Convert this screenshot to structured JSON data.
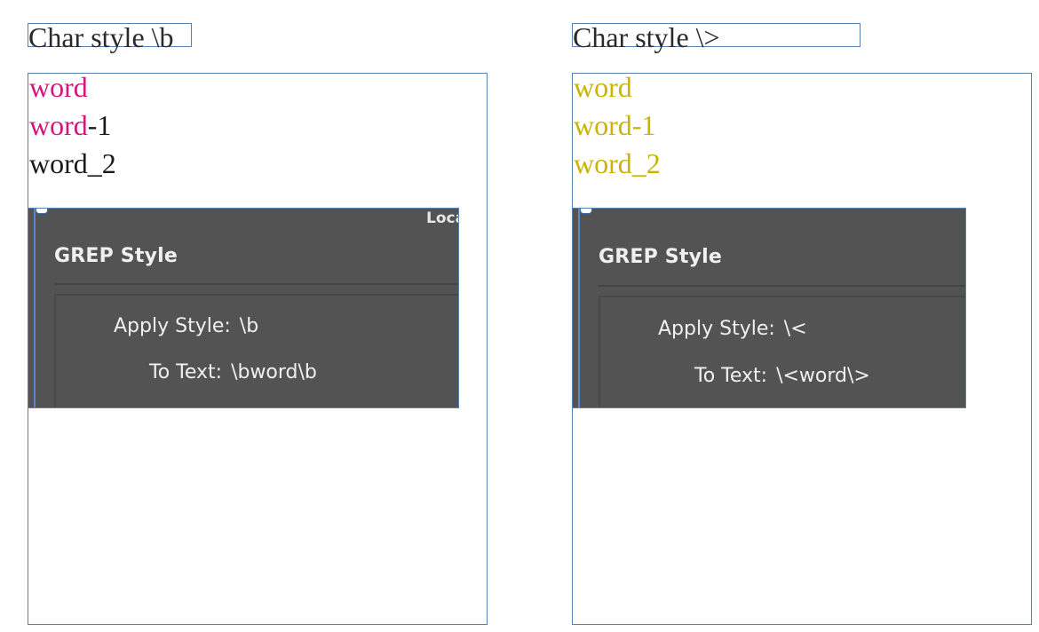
{
  "left": {
    "heading": "Char style \\b",
    "lines": [
      {
        "styled": "word",
        "rest": ""
      },
      {
        "styled": "word",
        "rest": "-1"
      },
      {
        "styled": "",
        "rest": "word_2"
      }
    ],
    "panel": {
      "corner_label": "Loca",
      "title": "GREP Style",
      "apply_style_label": "Apply Style:",
      "apply_style_value": "\\b",
      "to_text_label": "To Text:",
      "to_text_value": "\\bword\\b"
    }
  },
  "right": {
    "heading": "Char style \\>",
    "lines": [
      {
        "styled": "word",
        "rest": ""
      },
      {
        "styled": "word-1",
        "rest": ""
      },
      {
        "styled": "word_2",
        "rest": ""
      }
    ],
    "panel": {
      "title": "GREP Style",
      "apply_style_label": "Apply Style:",
      "apply_style_value": "\\<",
      "to_text_label": "To Text:",
      "to_text_value": "\\<word\\>"
    }
  },
  "colors": {
    "magenta": "#d3157f",
    "yellow": "#c9b400",
    "frame_border": "#5b7fae",
    "panel_bg": "#535353"
  },
  "icons": [
    "link-anchor-icon"
  ]
}
